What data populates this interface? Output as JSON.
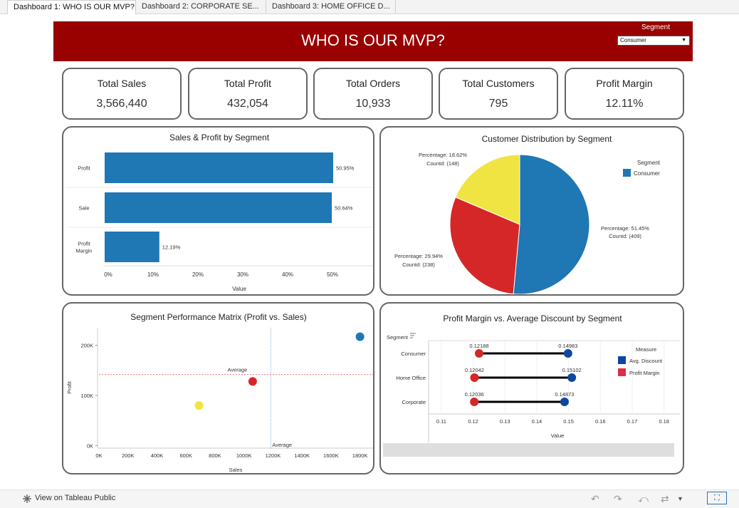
{
  "tabs": [
    {
      "label": "Dashboard 1: WHO IS OUR MVP?",
      "active": true
    },
    {
      "label": "Dashboard 2: CORPORATE SE...",
      "active": false
    },
    {
      "label": "Dashboard 3: HOME OFFICE D...",
      "active": false
    }
  ],
  "header": {
    "title": "WHO IS OUR MVP?",
    "segment_label": "Segment",
    "segment_value": "Consumer",
    "background": "#990000"
  },
  "kpis": [
    {
      "label": "Total Sales",
      "value": "3,566,440"
    },
    {
      "label": "Total Profit",
      "value": "432,054"
    },
    {
      "label": "Total Orders",
      "value": "10,933"
    },
    {
      "label": "Total Customers",
      "value": "795"
    },
    {
      "label": "Profit Margin",
      "value": "12.11%"
    }
  ],
  "charts": {
    "sales_profit": {
      "title": "Sales & Profit by Segment",
      "xlabel": "Value",
      "ticks": [
        "0%",
        "10%",
        "20%",
        "30%",
        "40%",
        "50%"
      ]
    },
    "customer_dist": {
      "title": "Customer Distribution by Segment",
      "legend_title": "Segment",
      "legend_item": "Consumer",
      "labels": [
        {
          "line1": "Percentage: 18.62%",
          "line2": "Countd: (148)"
        },
        {
          "line1": "Percentage: 51.45%",
          "line2": "Countd: (409)"
        },
        {
          "line1": "Percentage: 29.94%",
          "line2": "Countd: (238)"
        }
      ]
    },
    "matrix": {
      "title": "Segment Performance Matrix (Profit vs. Sales)",
      "xlabel": "Sales",
      "ylabel": "Profit",
      "avg_label_h": "Average",
      "avg_label_v": "Average",
      "yticks": [
        "0K",
        "100K",
        "200K"
      ],
      "xticks": [
        "0K",
        "200K",
        "400K",
        "600K",
        "800K",
        "1000K",
        "1200K",
        "1400K",
        "1600K",
        "1800K"
      ]
    },
    "dumbbell": {
      "title": "Profit Margin vs. Average Discount by Segment",
      "row_header": "Segment",
      "xlabel": "Value",
      "legend_title": "Measure",
      "legend": [
        "Avg. Discount",
        "Profit Margin"
      ],
      "xticks": [
        "0.11",
        "0.12",
        "0.13",
        "0.14",
        "0.15",
        "0.16",
        "0.17",
        "0.18"
      ]
    }
  },
  "footer": {
    "link": "View on Tableau Public"
  },
  "chart_data": [
    {
      "type": "bar",
      "title": "Sales & Profit by Segment",
      "orientation": "horizontal",
      "categories": [
        "Profit",
        "Sale",
        "Profit Margin"
      ],
      "values": [
        50.95,
        50.64,
        12.19
      ],
      "labels": [
        "50.95%",
        "50.64%",
        "12.19%"
      ],
      "xlabel": "Value",
      "xlim": [
        0,
        58
      ],
      "color": "#1f77b4"
    },
    {
      "type": "pie",
      "title": "Customer Distribution by Segment",
      "slices": [
        {
          "value": 51.45,
          "count": 409,
          "color": "#1f77b4"
        },
        {
          "value": 29.94,
          "count": 238,
          "color": "#d62728"
        },
        {
          "value": 18.62,
          "count": 148,
          "color": "#f0e442"
        }
      ]
    },
    {
      "type": "scatter",
      "title": "Segment Performance Matrix (Profit vs. Sales)",
      "xlabel": "Sales",
      "ylabel": "Profit",
      "xlim": [
        0,
        1900000
      ],
      "ylim": [
        -5000,
        235000
      ],
      "points": [
        {
          "x": 1800000,
          "y": 217000,
          "color": "#1f77b4"
        },
        {
          "x": 1060000,
          "y": 128000,
          "color": "#d62728"
        },
        {
          "x": 690000,
          "y": 80000,
          "color": "#f0e442"
        }
      ],
      "avg_x": 1185000,
      "avg_y": 142000
    },
    {
      "type": "dumbbell",
      "title": "Profit Margin vs. Average Discount by Segment",
      "categories": [
        "Consumer",
        "Home Office",
        "Corporate"
      ],
      "series": [
        {
          "name": "Profit Margin",
          "values": [
            0.12188,
            0.12042,
            0.12036
          ],
          "color": "#d62728"
        },
        {
          "name": "Avg. Discount",
          "values": [
            0.14983,
            0.15102,
            0.14873
          ],
          "color": "#0d47a1"
        }
      ],
      "labels_pm": [
        "0.12188",
        "0.12042",
        "0.12036"
      ],
      "labels_ad": [
        "0.14983",
        "0.15102",
        "0.14873"
      ],
      "xlim": [
        0.106,
        0.185
      ],
      "xlabel": "Value"
    }
  ]
}
